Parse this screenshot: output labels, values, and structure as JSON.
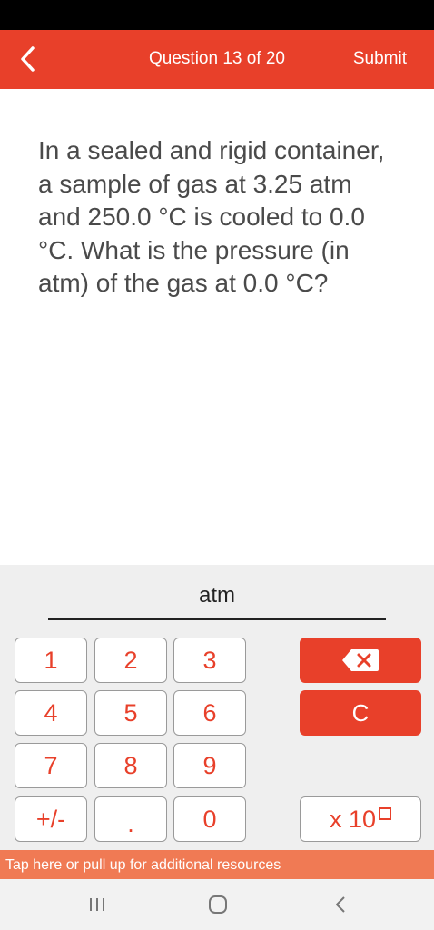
{
  "header": {
    "title": "Question 13 of 20",
    "submit_label": "Submit",
    "color": "#e8402a"
  },
  "question": {
    "text": "In a sealed and rigid container, a sample of gas at 3.25 atm and 250.0 °C is cooled to 0.0 °C. What is the pressure (in atm) of the gas at 0.0 °C?"
  },
  "answer": {
    "value": "",
    "unit": "atm"
  },
  "keypad": {
    "keys": [
      "1",
      "2",
      "3",
      "4",
      "5",
      "6",
      "7",
      "8",
      "9",
      "+/-",
      ".",
      "0"
    ],
    "backspace_icon": "backspace-icon",
    "clear_label": "C",
    "exponent_label": "x 10"
  },
  "resources": {
    "text": "Tap here or pull up for additional resources"
  },
  "nav": {
    "icons": [
      "recent-apps-icon",
      "home-icon",
      "back-icon"
    ]
  }
}
